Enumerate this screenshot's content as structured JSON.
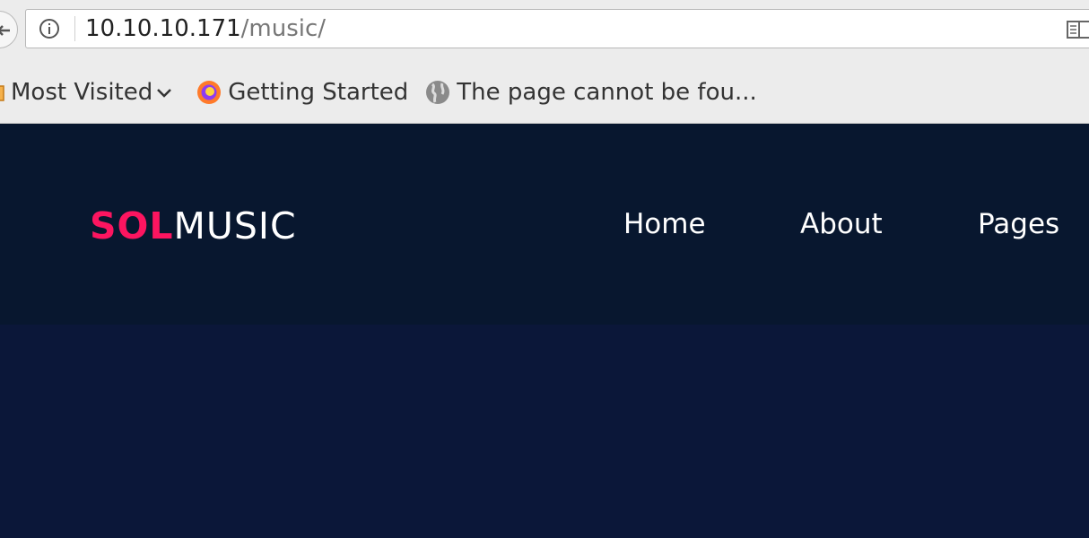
{
  "browser": {
    "url_host": "10.10.10.171",
    "url_path": "/music/",
    "bookmarks": [
      {
        "label": "Most Visited",
        "icon": "folder-icon"
      },
      {
        "label": "Getting Started",
        "icon": "firefox-icon"
      },
      {
        "label": "The page cannot be fou...",
        "icon": "globe-icon"
      }
    ]
  },
  "site": {
    "logo_part1": "SOL",
    "logo_part2": "MUSIC",
    "nav": [
      {
        "label": "Home"
      },
      {
        "label": "About"
      },
      {
        "label": "Pages"
      }
    ]
  },
  "colors": {
    "accent": "#fc1560",
    "header_bg": "#08172f",
    "hero_bg": "#0b1739"
  }
}
